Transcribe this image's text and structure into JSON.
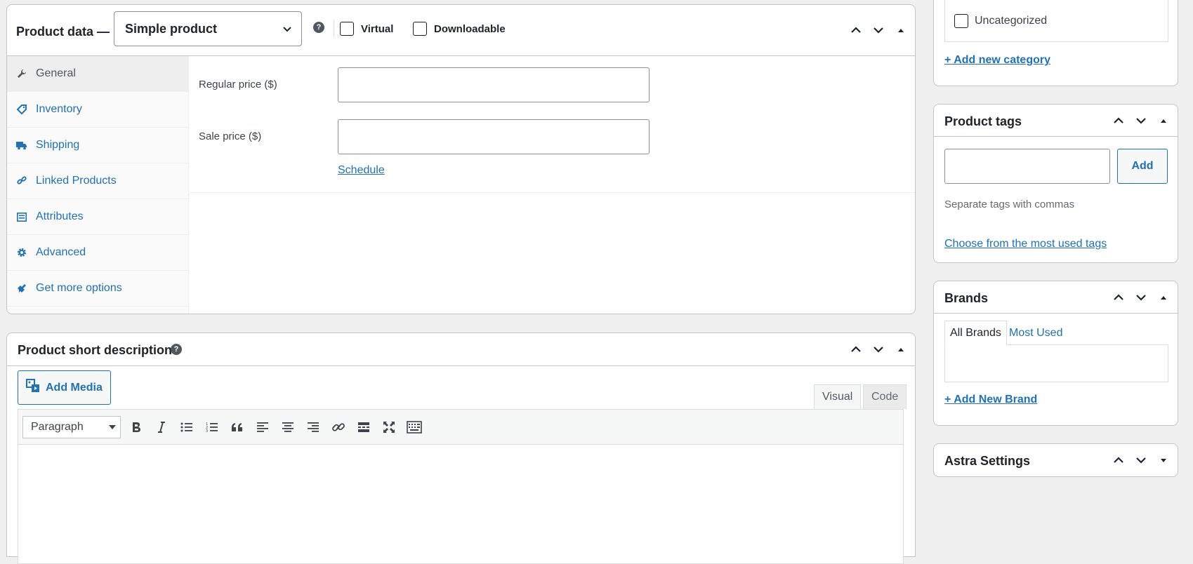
{
  "product_data": {
    "title": "Product data —",
    "product_type": "Simple product",
    "help": "?",
    "virtual_label": "Virtual",
    "downloadable_label": "Downloadable",
    "tabs": [
      {
        "label": "General",
        "icon": "wrench-icon"
      },
      {
        "label": "Inventory",
        "icon": "tag-icon"
      },
      {
        "label": "Shipping",
        "icon": "truck-icon"
      },
      {
        "label": "Linked Products",
        "icon": "link-icon"
      },
      {
        "label": "Attributes",
        "icon": "list-icon"
      },
      {
        "label": "Advanced",
        "icon": "gear-icon"
      },
      {
        "label": "Get more options",
        "icon": "plugin-icon"
      }
    ],
    "regular_price_label": "Regular price ($)",
    "regular_price_value": "",
    "sale_price_label": "Sale price ($)",
    "sale_price_value": "",
    "schedule_link": "Schedule"
  },
  "short_description": {
    "title": "Product short description",
    "help": "?",
    "add_media": "Add Media",
    "tab_visual": "Visual",
    "tab_code": "Code",
    "format": "Paragraph",
    "toolbar": [
      "bold-icon",
      "italic-icon",
      "bullet-list-icon",
      "numbered-list-icon",
      "blockquote-icon",
      "align-left-icon",
      "align-center-icon",
      "align-right-icon",
      "link-icon",
      "read-more-icon",
      "fullscreen-icon",
      "toolbar-toggle-icon"
    ]
  },
  "categories": {
    "item": "Uncategorized",
    "add_link": "+ Add new category"
  },
  "product_tags": {
    "title": "Product tags",
    "add_button": "Add",
    "hint": "Separate tags with commas",
    "choose_link": "Choose from the most used tags"
  },
  "brands": {
    "title": "Brands",
    "tab_all": "All Brands",
    "tab_most": "Most Used",
    "add_link": "+ Add New Brand"
  },
  "astra": {
    "title": "Astra Settings"
  },
  "colors": {
    "link": "#2271b1",
    "border": "#c3c4c7",
    "background": "#f0f0f1"
  }
}
